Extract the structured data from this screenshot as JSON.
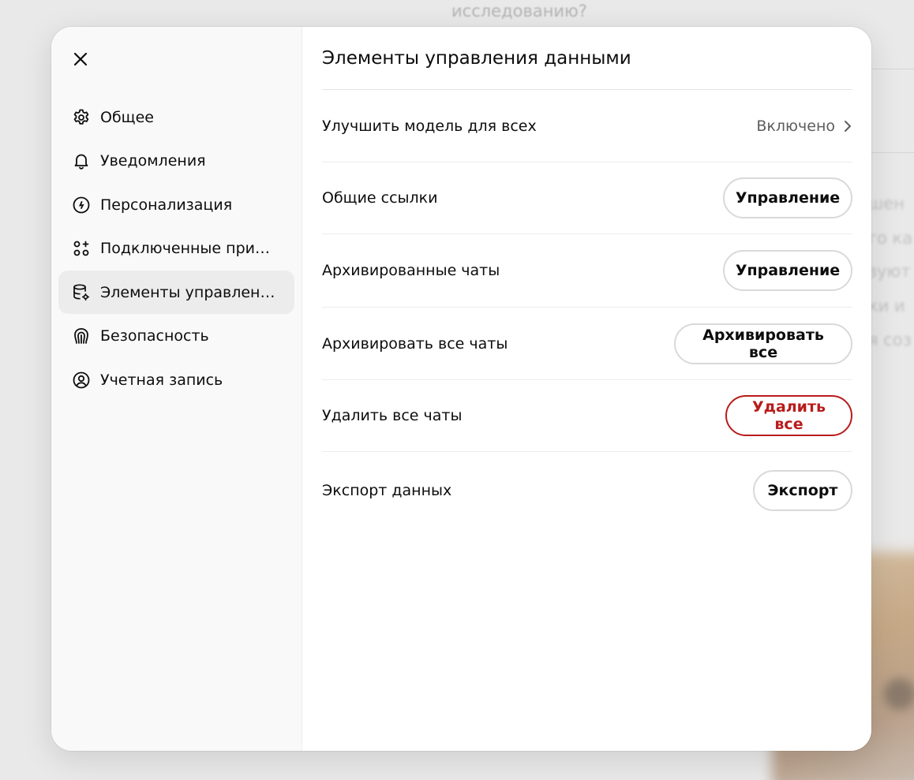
{
  "background": {
    "top_text": "исследованию?",
    "side_fragments": [
      "шен",
      "го ка",
      "зуют",
      "ки и",
      "я соз"
    ]
  },
  "modal": {
    "close_label": "×",
    "sidebar": {
      "items": [
        {
          "label": "Общее",
          "icon": "gear-icon",
          "active": false
        },
        {
          "label": "Уведомления",
          "icon": "bell-icon",
          "active": false
        },
        {
          "label": "Персонализация",
          "icon": "personalization-icon",
          "active": false
        },
        {
          "label": "Подключенные прил…",
          "icon": "connected-apps-icon",
          "active": false
        },
        {
          "label": "Элементы управлени…",
          "icon": "data-controls-icon",
          "active": true
        },
        {
          "label": "Безопасность",
          "icon": "security-icon",
          "active": false
        },
        {
          "label": "Учетная запись",
          "icon": "account-icon",
          "active": false
        }
      ]
    },
    "content": {
      "title": "Элементы управления данными",
      "rows": [
        {
          "label": "Улучшить модель для всех",
          "value": "Включено",
          "type": "link"
        },
        {
          "label": "Общие ссылки",
          "button": "Управление",
          "type": "button"
        },
        {
          "label": "Архивированные чаты",
          "button": "Управление",
          "type": "button"
        },
        {
          "label": "Архивировать все чаты",
          "button": "Архивировать все",
          "type": "button"
        },
        {
          "label": "Удалить все чаты",
          "button": "Удалить все",
          "type": "danger"
        },
        {
          "label": "Экспорт данных",
          "button": "Экспорт",
          "type": "button"
        }
      ]
    }
  },
  "colors": {
    "danger": "#b91c1c",
    "active_bg": "#ececec",
    "sidebar_bg": "#f9f9f9"
  }
}
